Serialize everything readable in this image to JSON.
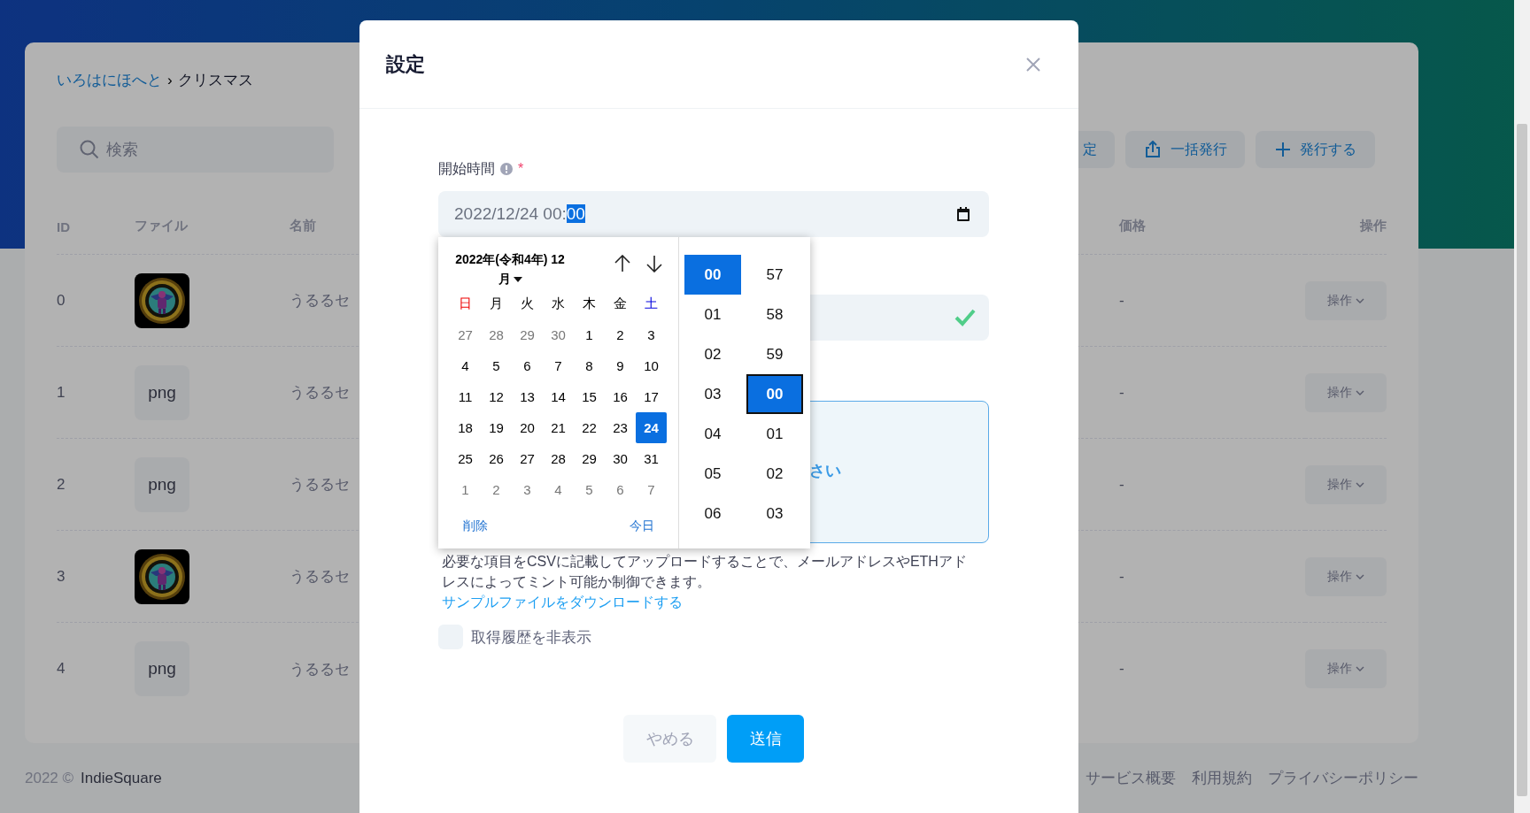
{
  "breadcrumb": {
    "parent": "いろはにほへと",
    "separator": "›",
    "current": "クリスマス"
  },
  "search": {
    "placeholder": "検索"
  },
  "toolbar_buttons": [
    {
      "label": "定",
      "kind": "plain"
    },
    {
      "label": "一括発行",
      "kind": "upload"
    },
    {
      "label": "発行する",
      "kind": "add"
    }
  ],
  "table": {
    "columns": [
      "ID",
      "ファイル",
      "名前",
      "価格",
      "操作"
    ],
    "rows": [
      {
        "id": "0",
        "name": "うるるセ",
        "price": "-",
        "action": "操作"
      },
      {
        "id": "1",
        "file": {
          "kind": "text",
          "label": "png"
        },
        "name": "うるるセ",
        "price": "-",
        "action": "操作"
      },
      {
        "id": "2",
        "file": {
          "kind": "text",
          "label": "png"
        },
        "name": "うるるセ",
        "price": "-",
        "action": "操作"
      },
      {
        "id": "3",
        "name": "うるるセ",
        "price": "-",
        "action": "操作"
      },
      {
        "id": "4",
        "file": {
          "kind": "text",
          "label": "png"
        },
        "name": "うるるセ",
        "price": "-",
        "action": "操作"
      }
    ]
  },
  "footer": {
    "copyright": "2022 ©",
    "brand": "IndieSquare",
    "links": [
      "サービス概要",
      "利用規約",
      "プライバシーポリシー"
    ]
  },
  "modal": {
    "title": "設定",
    "start_time": {
      "label": "開始時間",
      "required_mark": "*",
      "value": "2022/12/24 00:",
      "value_selected": "00"
    },
    "picker": {
      "title": "2022年(令和4年) 12 月",
      "weekdays": [
        {
          "label": "日",
          "kind": "sunday"
        },
        {
          "label": "月",
          "kind": "weekday"
        },
        {
          "label": "火",
          "kind": "weekday"
        },
        {
          "label": "水",
          "kind": "weekday"
        },
        {
          "label": "木",
          "kind": "weekday"
        },
        {
          "label": "金",
          "kind": "weekday"
        },
        {
          "label": "土",
          "kind": "saturday"
        }
      ],
      "days": [
        {
          "label": "27",
          "other_month": true,
          "selected": false
        },
        {
          "label": "28",
          "other_month": true,
          "selected": false
        },
        {
          "label": "29",
          "other_month": true,
          "selected": false
        },
        {
          "label": "30",
          "other_month": true,
          "selected": false
        },
        {
          "label": "1",
          "other_month": false,
          "selected": false
        },
        {
          "label": "2",
          "other_month": false,
          "selected": false
        },
        {
          "label": "3",
          "other_month": false,
          "selected": false
        },
        {
          "label": "4",
          "other_month": false,
          "selected": false
        },
        {
          "label": "5",
          "other_month": false,
          "selected": false
        },
        {
          "label": "6",
          "other_month": false,
          "selected": false
        },
        {
          "label": "7",
          "other_month": false,
          "selected": false
        },
        {
          "label": "8",
          "other_month": false,
          "selected": false
        },
        {
          "label": "9",
          "other_month": false,
          "selected": false
        },
        {
          "label": "10",
          "other_month": false,
          "selected": false
        },
        {
          "label": "11",
          "other_month": false,
          "selected": false
        },
        {
          "label": "12",
          "other_month": false,
          "selected": false
        },
        {
          "label": "13",
          "other_month": false,
          "selected": false
        },
        {
          "label": "14",
          "other_month": false,
          "selected": false
        },
        {
          "label": "15",
          "other_month": false,
          "selected": false
        },
        {
          "label": "16",
          "other_month": false,
          "selected": false
        },
        {
          "label": "17",
          "other_month": false,
          "selected": false
        },
        {
          "label": "18",
          "other_month": false,
          "selected": false
        },
        {
          "label": "19",
          "other_month": false,
          "selected": false
        },
        {
          "label": "20",
          "other_month": false,
          "selected": false
        },
        {
          "label": "21",
          "other_month": false,
          "selected": false
        },
        {
          "label": "22",
          "other_month": false,
          "selected": false
        },
        {
          "label": "23",
          "other_month": false,
          "selected": false
        },
        {
          "label": "24",
          "other_month": false,
          "selected": true
        },
        {
          "label": "25",
          "other_month": false,
          "selected": false
        },
        {
          "label": "26",
          "other_month": false,
          "selected": false
        },
        {
          "label": "27",
          "other_month": false,
          "selected": false
        },
        {
          "label": "28",
          "other_month": false,
          "selected": false
        },
        {
          "label": "29",
          "other_month": false,
          "selected": false
        },
        {
          "label": "30",
          "other_month": false,
          "selected": false
        },
        {
          "label": "31",
          "other_month": false,
          "selected": false
        },
        {
          "label": "1",
          "other_month": true,
          "selected": false
        },
        {
          "label": "2",
          "other_month": true,
          "selected": false
        },
        {
          "label": "3",
          "other_month": true,
          "selected": false
        },
        {
          "label": "4",
          "other_month": true,
          "selected": false
        },
        {
          "label": "5",
          "other_month": true,
          "selected": false
        },
        {
          "label": "6",
          "other_month": true,
          "selected": false
        },
        {
          "label": "7",
          "other_month": true,
          "selected": false
        }
      ],
      "clear": "削除",
      "today": "今日",
      "hours": [
        {
          "label": "00",
          "selected": true
        },
        {
          "label": "01",
          "selected": false
        },
        {
          "label": "02",
          "selected": false
        },
        {
          "label": "03",
          "selected": false
        },
        {
          "label": "04",
          "selected": false
        },
        {
          "label": "05",
          "selected": false
        },
        {
          "label": "06",
          "selected": false
        }
      ],
      "minutes": [
        {
          "label": "57",
          "selected": false,
          "focused": false
        },
        {
          "label": "58",
          "selected": false,
          "focused": false
        },
        {
          "label": "59",
          "selected": false,
          "focused": false
        },
        {
          "label": "00",
          "selected": true,
          "focused": true
        },
        {
          "label": "01",
          "selected": false,
          "focused": false
        },
        {
          "label": "02",
          "selected": false,
          "focused": false
        },
        {
          "label": "03",
          "selected": false,
          "focused": false
        }
      ]
    },
    "second_field": {
      "valid": true
    },
    "upload_box": {
      "text": "さい"
    },
    "description": "必要な項目をCSVに記載してアップロードすることで、メールアドレスやETHアドレスによってミント可能か制御できます。",
    "sample_link": "サンプルファイルをダウンロードする",
    "hide_history": {
      "label": "取得履歴を非表示",
      "checked": false
    },
    "buttons": [
      {
        "label": "やめる",
        "kind": "secondary"
      },
      {
        "label": "送信",
        "kind": "primary"
      }
    ]
  }
}
